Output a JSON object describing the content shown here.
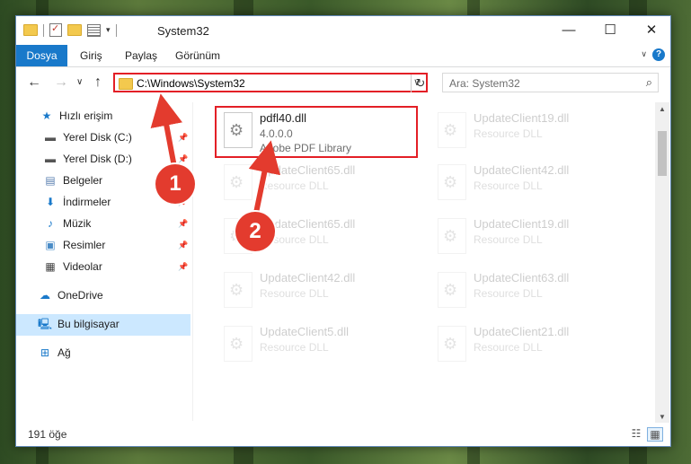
{
  "window": {
    "title": "System32",
    "minimize_glyph": "—",
    "maximize_glyph": "☐",
    "close_glyph": "✕"
  },
  "ribbon": {
    "tabs": [
      "Dosya",
      "Giriş",
      "Paylaş",
      "Görünüm"
    ],
    "help_glyph": "?",
    "collapse_glyph": "∨"
  },
  "navigation": {
    "back_glyph": "←",
    "forward_glyph": "→",
    "recent_glyph": "∨",
    "up_glyph": "↑",
    "address": "C:\\Windows\\System32",
    "address_chevron": "∨",
    "refresh_glyph": "↻",
    "search_placeholder": "Ara: System32",
    "search_glyph": "⌕"
  },
  "sidebar": {
    "items": [
      {
        "label": "Hızlı erişim",
        "icon": "star-icon",
        "glyph": "★",
        "color": "#1979ca"
      },
      {
        "label": "Yerel Disk (C:)",
        "icon": "drive-icon",
        "glyph": "▬",
        "color": "#555555",
        "pinned": true
      },
      {
        "label": "Yerel Disk (D:)",
        "icon": "drive-icon",
        "glyph": "▬",
        "color": "#555555",
        "pinned": true
      },
      {
        "label": "Belgeler",
        "icon": "documents-icon",
        "glyph": "▤",
        "color": "#5a7fb0",
        "pinned": true
      },
      {
        "label": "İndirmeler",
        "icon": "download-icon",
        "glyph": "⬇",
        "color": "#1979ca",
        "pinned": true
      },
      {
        "label": "Müzik",
        "icon": "music-icon",
        "glyph": "♪",
        "color": "#1979ca",
        "pinned": true
      },
      {
        "label": "Resimler",
        "icon": "pictures-icon",
        "glyph": "▣",
        "color": "#4a8cc7",
        "pinned": true
      },
      {
        "label": "Videolar",
        "icon": "video-icon",
        "glyph": "▦",
        "color": "#444444",
        "pinned": true
      },
      {
        "label": "OneDrive",
        "icon": "cloud-icon",
        "glyph": "☁",
        "color": "#1979ca"
      },
      {
        "label": "Bu bilgisayar",
        "icon": "computer-icon",
        "glyph": "🖳",
        "color": "#1979ca",
        "selected": true
      },
      {
        "label": "Ağ",
        "icon": "network-icon",
        "glyph": "⊞",
        "color": "#1979ca"
      }
    ],
    "pin_glyph": "📌"
  },
  "files": {
    "featured": {
      "name": "pdfl40.dll",
      "version": "4.0.0.0",
      "description": "Adobe PDF Library"
    },
    "left_column": [
      {
        "name": "UpdateClient65.dll",
        "description": "Resource DLL"
      },
      {
        "name": "UpdateClient65.dll",
        "description": "Resource DLL"
      },
      {
        "name": "UpdateClient42.dll",
        "description": "Resource DLL"
      },
      {
        "name": "UpdateClient5.dll",
        "description": "Resource DLL"
      }
    ],
    "right_column": [
      {
        "name": "UpdateClient19.dll",
        "description": "Resource DLL"
      },
      {
        "name": "UpdateClient42.dll",
        "description": "Resource DLL"
      },
      {
        "name": "UpdateClient19.dll",
        "description": "Resource DLL"
      },
      {
        "name": "UpdateClient63.dll",
        "description": "Resource DLL"
      },
      {
        "name": "UpdateClient21.dll",
        "description": "Resource DLL"
      }
    ]
  },
  "status": {
    "item_count": "191 öğe"
  },
  "annotations": {
    "marker_1": "1",
    "marker_2": "2",
    "accent_color": "#e33b2e"
  }
}
